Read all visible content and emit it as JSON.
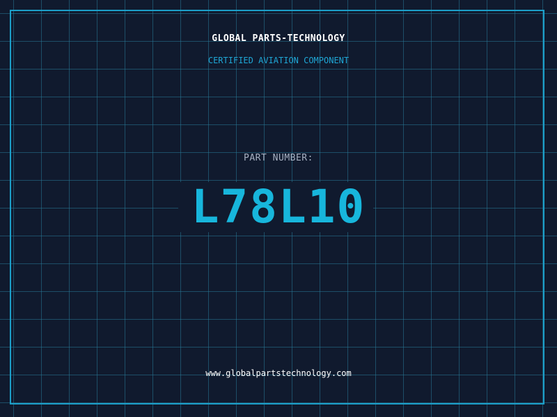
{
  "label": {
    "brand_name": "GLOBAL PARTS-TECHNOLOGY",
    "tagline": "CERTIFIED AVIATION COMPONENT",
    "part_label": "PART NUMBER:",
    "part_number": "L78L10",
    "website": "www.globalpartstechnology.com"
  },
  "colors": {
    "background": "#101a2e",
    "grid": "#28788f",
    "accent": "#1c9fc9",
    "part_number": "#17b6dc",
    "text_primary": "#ffffff",
    "text_muted": "#a7b1c2"
  }
}
